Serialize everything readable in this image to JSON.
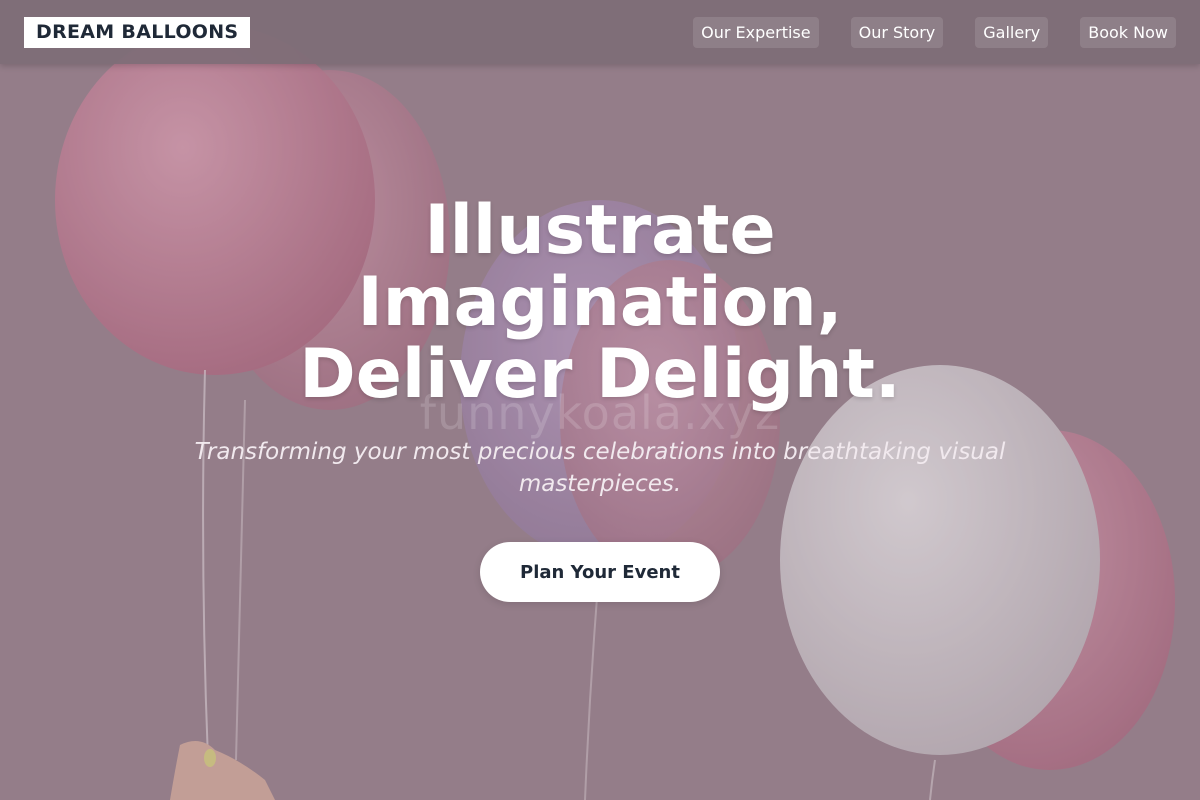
{
  "brand": {
    "logo_text": "DREAM BALLOONS"
  },
  "nav": {
    "items": [
      {
        "label": "Our Expertise"
      },
      {
        "label": "Our Story"
      },
      {
        "label": "Gallery"
      },
      {
        "label": "Book Now"
      }
    ]
  },
  "hero": {
    "title_line1": "Illustrate",
    "title_line2": "Imagination,",
    "title_line3": "Deliver Delight.",
    "subtitle": "Transforming your most precious celebrations into breathtaking visual masterpieces.",
    "cta_label": "Plan Your Event",
    "watermark": "funnykoala.xyz"
  },
  "colors": {
    "header_bg": "#7d6c76",
    "logo_text": "#1f2937",
    "cta_bg": "#ffffff",
    "cta_text": "#1f2937",
    "balloon_pink": "#d98ba6",
    "balloon_white": "#f2eef1"
  }
}
